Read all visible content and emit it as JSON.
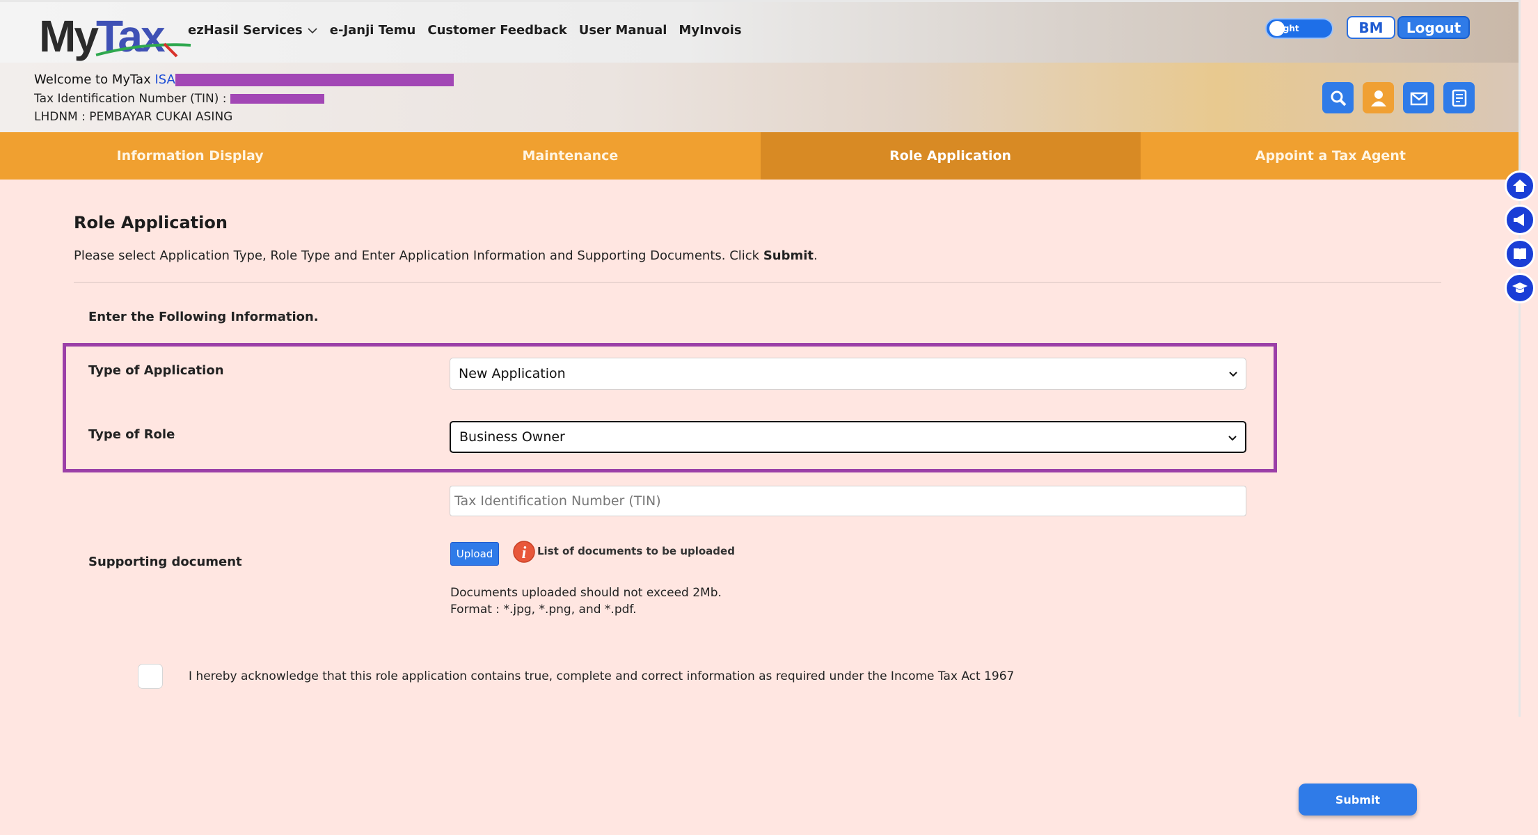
{
  "header": {
    "logo": {
      "part1": "My",
      "part2": "Tax"
    },
    "nav": [
      {
        "label": "ezHasil Services"
      },
      {
        "label": "e-Janji Temu"
      },
      {
        "label": "Customer Feedback"
      },
      {
        "label": "User Manual"
      },
      {
        "label": "MyInvois"
      }
    ],
    "theme_toggle_label": "Light",
    "lang_button": "BM",
    "logout_button": "Logout"
  },
  "info": {
    "welcome_prefix": "Welcome to MyTax ",
    "welcome_name": "ISA",
    "tin_label": "Tax Identification Number (TIN) :",
    "lhdnm": "LHDNM : PEMBAYAR CUKAI ASING"
  },
  "tabs": [
    {
      "label": "Information Display"
    },
    {
      "label": "Maintenance"
    },
    {
      "label": "Role Application"
    },
    {
      "label": "Appoint a Tax Agent"
    }
  ],
  "main": {
    "title": "Role Application",
    "instruction_text": "Please select Application Type, Role Type and Enter Application Information and Supporting Documents. Click ",
    "instruction_bold": "Submit",
    "instruction_end": ".",
    "enter_info": "Enter the Following Information.",
    "type_of_application_label": "Type of Application",
    "type_of_application_value": "New Application",
    "type_of_role_label": "Type of Role",
    "type_of_role_value": "Business Owner",
    "tin_placeholder": "Tax Identification Number (TIN)",
    "supporting_doc_label": "Supporting document",
    "upload_button": "Upload",
    "doc_list_link": "List of documents to be uploaded",
    "note_size": "Documents uploaded should not exceed 2Mb.",
    "note_format": "Format : *.jpg, *.png, and *.pdf.",
    "acknowledgement": "I hereby acknowledge that this role application contains true, complete and correct information as required under the Income Tax Act 1967",
    "submit_button": "Submit"
  },
  "colors": {
    "accent_blue": "#2f7be8",
    "tab_orange": "#f0a030",
    "tab_active": "#d88a24",
    "highlight_purple": "#9b3fa7",
    "page_bg": "#ffe6e1"
  }
}
